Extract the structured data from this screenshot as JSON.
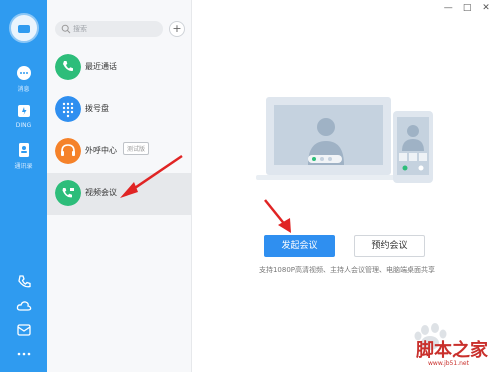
{
  "window": {
    "controls": [
      "—",
      "□",
      "✕"
    ]
  },
  "rail": {
    "items": [
      {
        "label": "消息",
        "icon": "chat-icon"
      },
      {
        "label": "DING",
        "icon": "ding-icon"
      },
      {
        "label": "通讯录",
        "icon": "contacts-icon"
      }
    ],
    "bottom": [
      "phone-icon",
      "cloud-icon",
      "mail-icon",
      "more-icon"
    ]
  },
  "list": {
    "search_placeholder": "搜索",
    "add_label": "+",
    "entries": [
      {
        "label": "最近通话",
        "color": "#2dbd7a",
        "icon": "phone-icon"
      },
      {
        "label": "拨号盘",
        "color": "#2f8ff0",
        "icon": "dialpad-icon"
      },
      {
        "label": "外呼中心",
        "color": "#f5822a",
        "icon": "headset-icon",
        "badge": "测试版"
      },
      {
        "label": "视频会议",
        "color": "#2dbd7a",
        "icon": "video-call-icon",
        "active": true
      }
    ]
  },
  "main": {
    "start_label": "发起会议",
    "schedule_label": "预约会议",
    "description": "支持1080P高清视频、主持人会议管理、电脑端桌面共享"
  },
  "watermark": {
    "title": "脚本之家",
    "url": "www.jb51.net"
  },
  "colors": {
    "rail": "#2f9bf0",
    "primary": "#2f8ff0",
    "arrow": "#e02424"
  }
}
